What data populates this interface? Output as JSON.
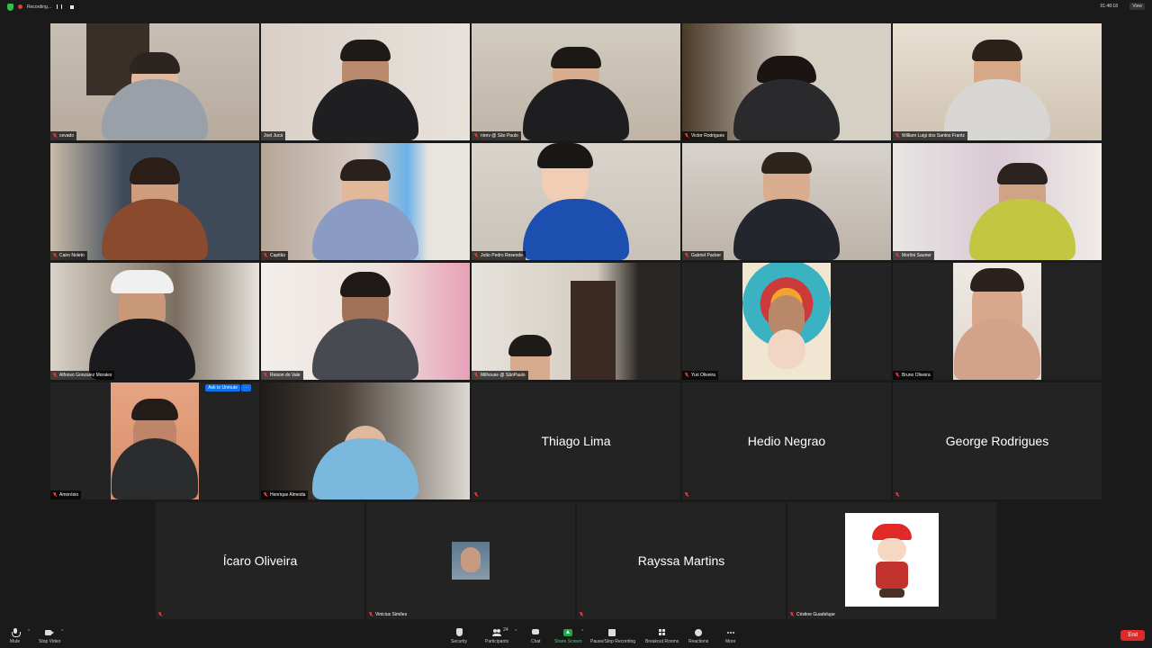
{
  "topbar": {
    "recording_label": "Recording...",
    "clock": "01:48:18",
    "view_label": "View"
  },
  "tiles": [
    {
      "name": "cevado"
    },
    {
      "name": "Joel Jucá"
    },
    {
      "name": "nirev @ São Paulo"
    },
    {
      "name": "Victor Rodrigues"
    },
    {
      "name": "William Luigi dos Santos Frantz"
    },
    {
      "name": "Cairo Noleto"
    },
    {
      "name": "Capitão"
    },
    {
      "name": "João Pedro Resende"
    },
    {
      "name": "Gabriel Packer"
    },
    {
      "name": "Morôni Sauner"
    },
    {
      "name": "Alfonso Gonzalez Morales"
    },
    {
      "name": "Reison do Vale"
    },
    {
      "name": "Milhouse @ SãoPaulo"
    },
    {
      "name": "Yuri Oliveira"
    },
    {
      "name": "Bruno Oliveira"
    },
    {
      "name": "Amorésio"
    },
    {
      "name": "Henrique Almeida"
    },
    {
      "name": "Thiago Lima"
    },
    {
      "name": "Hedio Negrao"
    },
    {
      "name": "George Rodrigues"
    },
    {
      "name": "Ícaro Oliveira"
    },
    {
      "name": "Vinicius Simões"
    },
    {
      "name": "Rayssa Martins"
    },
    {
      "name": "Cristine Guadelupe"
    }
  ],
  "ask_to_unmute": "Ask to Unmute",
  "toolbar": {
    "mute": "Mute",
    "stop_video": "Stop Video",
    "security": "Security",
    "participants": "Participants",
    "participants_count": "24",
    "chat": "Chat",
    "share_screen": "Share Screen",
    "pause_recording": "Pause/Stop Recording",
    "breakout_rooms": "Breakout Rooms",
    "reactions": "Reactions",
    "more": "More",
    "end": "End"
  },
  "colors": {
    "active_speaker": "#e6e84f",
    "end_button": "#e02828",
    "share_screen": "#1ea84a",
    "ask_unmute": "#0e72ed"
  }
}
